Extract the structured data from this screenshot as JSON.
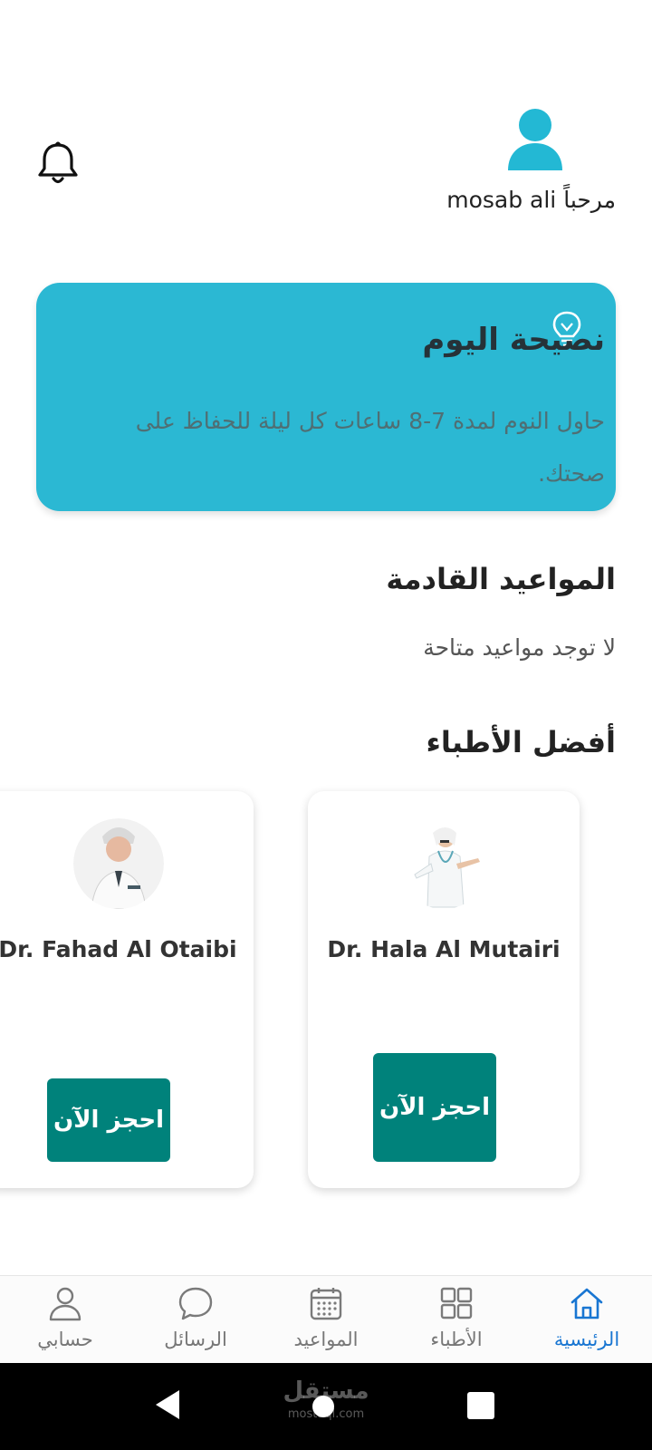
{
  "header": {
    "greeting": "مرحباً mosab ali",
    "user_icon": "user-avatar-icon",
    "notification_icon": "bell-icon"
  },
  "tip": {
    "title": "نصيحة اليوم",
    "text": "حاول النوم لمدة 7-8 ساعات كل ليلة للحفاظ على صحتك.",
    "icon": "lightbulb-icon"
  },
  "appointments": {
    "title": "المواعيد القادمة",
    "empty_text": "لا توجد مواعيد متاحة"
  },
  "top_doctors": {
    "title": "أفضل الأطباء",
    "doctors": [
      {
        "name": "Dr. Hala Al Mutairi",
        "book_label": "احجز الآن"
      },
      {
        "name": "Dr. Fahad Al Otaibi",
        "book_label": "احجز الآن"
      }
    ]
  },
  "bottom_nav": {
    "items": [
      {
        "label": "الرئيسية",
        "icon": "home-icon",
        "active": true
      },
      {
        "label": "الأطباء",
        "icon": "grid-icon",
        "active": false
      },
      {
        "label": "المواعيد",
        "icon": "calendar-icon",
        "active": false
      },
      {
        "label": "الرسائل",
        "icon": "chat-bubble-icon",
        "active": false
      },
      {
        "label": "حسابي",
        "icon": "user-icon",
        "active": false
      }
    ]
  },
  "system_bar": {
    "watermark": "مستقل",
    "watermark_sub": "mostaql.com"
  },
  "colors": {
    "accent": "#2bb8d3",
    "button": "#00827b",
    "nav_active": "#1976d2"
  }
}
